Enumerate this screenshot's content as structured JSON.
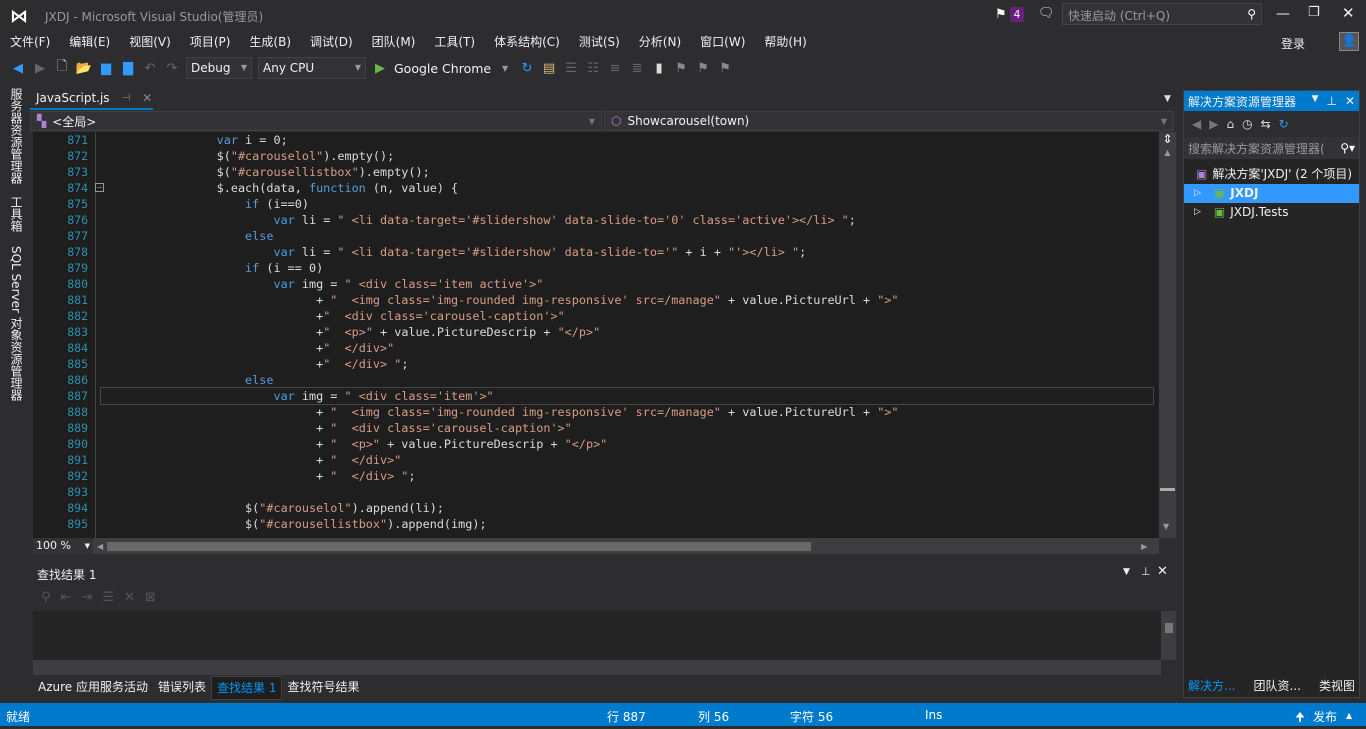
{
  "window": {
    "title": "JXDJ - Microsoft Visual Studio(管理员)",
    "notification_count": "4",
    "quick_launch_placeholder": "快速启动 (Ctrl+Q)",
    "sign_in": "登录"
  },
  "menu": [
    "文件(F)",
    "编辑(E)",
    "视图(V)",
    "项目(P)",
    "生成(B)",
    "调试(D)",
    "团队(M)",
    "工具(T)",
    "体系结构(C)",
    "测试(S)",
    "分析(N)",
    "窗口(W)",
    "帮助(H)"
  ],
  "toolbar": {
    "configuration": "Debug",
    "platform": "Any CPU",
    "run_target": "Google Chrome"
  },
  "left_tabs": [
    "服务器资源管理器",
    "工具箱",
    "SQL Server 对象资源管理器"
  ],
  "editor": {
    "tab": "JavaScript.js",
    "scope": "<全局>",
    "member": "Showcarousel(town)",
    "zoom": "100 %",
    "current_line": 887,
    "lines": [
      {
        "n": "871",
        "seg": [
          [
            "p",
            "                "
          ],
          [
            "k",
            "var"
          ],
          [
            "p",
            " i = 0;"
          ]
        ]
      },
      {
        "n": "872",
        "seg": [
          [
            "p",
            "                $("
          ],
          [
            "s",
            "\"#carouselol\""
          ],
          [
            "p",
            ").empty();"
          ]
        ]
      },
      {
        "n": "873",
        "seg": [
          [
            "p",
            "                $("
          ],
          [
            "s",
            "\"#carousellistbox\""
          ],
          [
            "p",
            ").empty();"
          ]
        ]
      },
      {
        "n": "874",
        "seg": [
          [
            "p",
            "                $.each(data, "
          ],
          [
            "k",
            "function"
          ],
          [
            "p",
            " (n, value) {"
          ]
        ]
      },
      {
        "n": "875",
        "seg": [
          [
            "p",
            "                    "
          ],
          [
            "k",
            "if"
          ],
          [
            "p",
            " (i==0)"
          ]
        ]
      },
      {
        "n": "876",
        "seg": [
          [
            "p",
            "                        "
          ],
          [
            "k",
            "var"
          ],
          [
            "p",
            " li = "
          ],
          [
            "s",
            "\" <li data-target='#slidershow' data-slide-to='0' class='active'></li> \""
          ],
          [
            "p",
            ";"
          ]
        ]
      },
      {
        "n": "877",
        "seg": [
          [
            "p",
            "                    "
          ],
          [
            "k",
            "else"
          ]
        ]
      },
      {
        "n": "878",
        "seg": [
          [
            "p",
            "                        "
          ],
          [
            "k",
            "var"
          ],
          [
            "p",
            " li = "
          ],
          [
            "s",
            "\" <li data-target='#slidershow' data-slide-to='\""
          ],
          [
            "p",
            " + i + "
          ],
          [
            "s",
            "\"'></li> \""
          ],
          [
            "p",
            ";"
          ]
        ]
      },
      {
        "n": "879",
        "seg": [
          [
            "p",
            "                    "
          ],
          [
            "k",
            "if"
          ],
          [
            "p",
            " (i == 0)"
          ]
        ]
      },
      {
        "n": "880",
        "seg": [
          [
            "p",
            "                        "
          ],
          [
            "k",
            "var"
          ],
          [
            "p",
            " img = "
          ],
          [
            "s",
            "\" <div class='item active'>\""
          ]
        ]
      },
      {
        "n": "881",
        "seg": [
          [
            "p",
            "                              + "
          ],
          [
            "s",
            "\"  <img class='img-rounded img-responsive' src=/manage\""
          ],
          [
            "p",
            " + value.PictureUrl + "
          ],
          [
            "s",
            "\">\""
          ]
        ]
      },
      {
        "n": "882",
        "seg": [
          [
            "p",
            "                              +"
          ],
          [
            "s",
            "\"  <div class='carousel-caption'>\""
          ]
        ]
      },
      {
        "n": "883",
        "seg": [
          [
            "p",
            "                              +"
          ],
          [
            "s",
            "\"  <p>\""
          ],
          [
            "p",
            " + value.PictureDescrip + "
          ],
          [
            "s",
            "\"</p>\""
          ]
        ]
      },
      {
        "n": "884",
        "seg": [
          [
            "p",
            "                              +"
          ],
          [
            "s",
            "\"  </div>\""
          ]
        ]
      },
      {
        "n": "885",
        "seg": [
          [
            "p",
            "                              +"
          ],
          [
            "s",
            "\"  </div> \""
          ],
          [
            "p",
            ";"
          ]
        ]
      },
      {
        "n": "886",
        "seg": [
          [
            "p",
            "                    "
          ],
          [
            "k",
            "else"
          ]
        ]
      },
      {
        "n": "887",
        "seg": [
          [
            "p",
            "                        "
          ],
          [
            "k",
            "var"
          ],
          [
            "p",
            " img = "
          ],
          [
            "s",
            "\" <div class='item'>\""
          ]
        ]
      },
      {
        "n": "888",
        "seg": [
          [
            "p",
            "                              + "
          ],
          [
            "s",
            "\"  <img class='img-rounded img-responsive' src=/manage\""
          ],
          [
            "p",
            " + value.PictureUrl + "
          ],
          [
            "s",
            "\">\""
          ]
        ]
      },
      {
        "n": "889",
        "seg": [
          [
            "p",
            "                              + "
          ],
          [
            "s",
            "\"  <div class='carousel-caption'>\""
          ]
        ]
      },
      {
        "n": "890",
        "seg": [
          [
            "p",
            "                              + "
          ],
          [
            "s",
            "\"  <p>\""
          ],
          [
            "p",
            " + value.PictureDescrip + "
          ],
          [
            "s",
            "\"</p>\""
          ]
        ]
      },
      {
        "n": "891",
        "seg": [
          [
            "p",
            "                              + "
          ],
          [
            "s",
            "\"  </div>\""
          ]
        ]
      },
      {
        "n": "892",
        "seg": [
          [
            "p",
            "                              + "
          ],
          [
            "s",
            "\"  </div> \""
          ],
          [
            "p",
            ";"
          ]
        ]
      },
      {
        "n": "893",
        "seg": [
          [
            "p",
            ""
          ]
        ]
      },
      {
        "n": "894",
        "seg": [
          [
            "p",
            "                    $("
          ],
          [
            "s",
            "\"#carouselol\""
          ],
          [
            "p",
            ").append(li);"
          ]
        ]
      },
      {
        "n": "895",
        "seg": [
          [
            "p",
            "                    $("
          ],
          [
            "s",
            "\"#carousellistbox\""
          ],
          [
            "p",
            ").append(img);"
          ]
        ]
      }
    ]
  },
  "find_panel": {
    "title": "查找结果 1"
  },
  "bottom_tabs": [
    {
      "label": "Azure 应用服务活动",
      "active": false
    },
    {
      "label": "错误列表",
      "active": false
    },
    {
      "label": "查找结果 1",
      "active": true
    },
    {
      "label": "查找符号结果",
      "active": false
    }
  ],
  "solution_explorer": {
    "title": "解决方案资源管理器",
    "search_placeholder": "搜索解决方案资源管理器(",
    "solution": "解决方案'JXDJ' (2 个项目)",
    "projects": [
      {
        "name": "JXDJ",
        "selected": true
      },
      {
        "name": "JXDJ.Tests",
        "selected": false
      }
    ],
    "tabs": [
      "解决方...",
      "团队资...",
      "类视图"
    ]
  },
  "status": {
    "ready": "就绪",
    "line": "行 887",
    "col": "列 56",
    "char": "字符 56",
    "mode": "Ins",
    "publish": "发布"
  },
  "colors": {
    "accent": "#007acc",
    "keyword": "#569cd6",
    "string": "#d69d85",
    "line_number": "#2b91af"
  }
}
